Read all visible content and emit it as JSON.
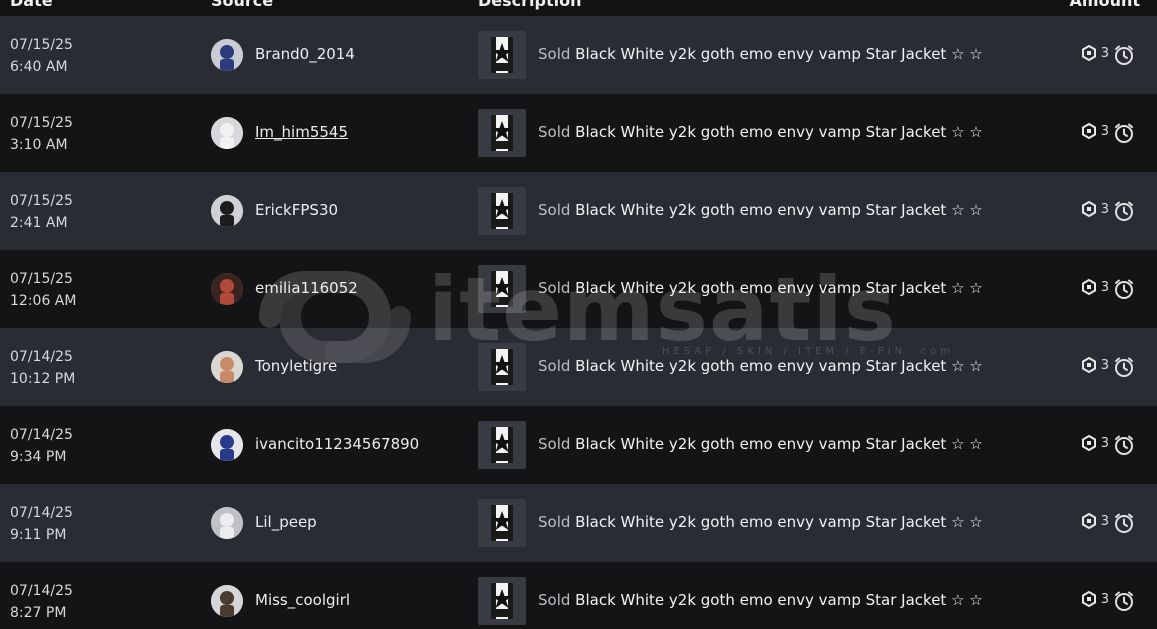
{
  "table": {
    "headers": {
      "date": "Date",
      "source": "Source",
      "description": "Description",
      "amount": "Amount"
    },
    "rows": [
      {
        "date": "07/15/25",
        "time": "6:40 AM",
        "user": "Brand0_2014",
        "underline": false,
        "sold": "Sold",
        "item": "Black White y2k goth emo envy vamp Star Jacket ☆ ☆",
        "amount": "3",
        "avatar_icon": "avatar-icon"
      },
      {
        "date": "07/15/25",
        "time": "3:10 AM",
        "user": "Im_him5545",
        "underline": true,
        "sold": "Sold",
        "item": "Black White y2k goth emo envy vamp Star Jacket ☆ ☆",
        "amount": "3",
        "avatar_icon": "avatar-icon"
      },
      {
        "date": "07/15/25",
        "time": "2:41 AM",
        "user": "ErickFPS30",
        "underline": false,
        "sold": "Sold",
        "item": "Black White y2k goth emo envy vamp Star Jacket ☆ ☆",
        "amount": "3",
        "avatar_icon": "avatar-icon"
      },
      {
        "date": "07/15/25",
        "time": "12:06 AM",
        "user": "emilia116052",
        "underline": false,
        "sold": "Sold",
        "item": "Black White y2k goth emo envy vamp Star Jacket ☆ ☆",
        "amount": "3",
        "avatar_icon": "avatar-icon"
      },
      {
        "date": "07/14/25",
        "time": "10:12 PM",
        "user": "Tonyletigre",
        "underline": false,
        "sold": "Sold",
        "item": "Black White y2k goth emo envy vamp Star Jacket ☆ ☆",
        "amount": "3",
        "avatar_icon": "avatar-icon"
      },
      {
        "date": "07/14/25",
        "time": "9:34 PM",
        "user": "ivancito11234567890",
        "underline": false,
        "sold": "Sold",
        "item": "Black White y2k goth emo envy vamp Star Jacket ☆ ☆",
        "amount": "3",
        "avatar_icon": "avatar-icon"
      },
      {
        "date": "07/14/25",
        "time": "9:11 PM",
        "user": "Lil_peep",
        "underline": false,
        "sold": "Sold",
        "item": "Black White y2k goth emo envy vamp Star Jacket ☆ ☆",
        "amount": "3",
        "avatar_icon": "avatar-icon"
      },
      {
        "date": "07/14/25",
        "time": "8:27 PM",
        "user": "Miss_coolgirl",
        "underline": false,
        "sold": "Sold",
        "item": "Black White y2k goth emo envy vamp Star Jacket ☆ ☆",
        "amount": "3",
        "avatar_icon": "avatar-icon"
      }
    ]
  },
  "watermark": {
    "word": "itemsatis",
    "sub": "HESAP / SKIN / ITEM / E-PIN .com"
  },
  "colors": {
    "row_odd": "#2a2c33",
    "row_even": "#141417",
    "background": "#121215"
  },
  "icons": {
    "currency": "robux-icon",
    "status": "pending-clock-icon",
    "item": "jacket-thumbnail"
  }
}
